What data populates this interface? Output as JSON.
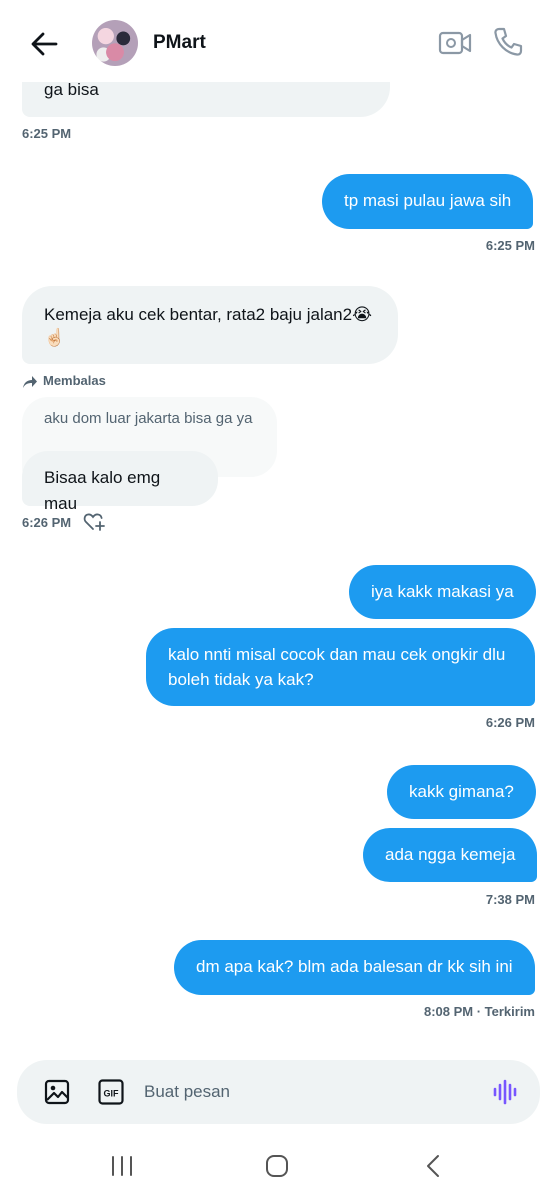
{
  "header": {
    "contact_name": "PMart"
  },
  "messages": {
    "m1_text": "ga bisa",
    "m1_time": "6:25 PM",
    "m2_text": "tp masi pulau jawa sih",
    "m2_time": "6:25 PM",
    "m3_text_line1": "Kemeja aku cek bentar, rata2 baju jalan2😭",
    "m3_text_line2": "☝🏻",
    "reply_label": "Membalas",
    "reply_quote": "aku dom luar jakarta bisa ga ya",
    "m4_text": "Bisaa kalo emg mau",
    "m4_time": "6:26 PM",
    "m5_text": "iya kakk makasi ya",
    "m6_text_line1": "kalo nnti misal cocok dan mau cek ongkir dlu",
    "m6_text_line2": "boleh tidak ya kak?",
    "m6_time": "6:26 PM",
    "m7_text": "kakk gimana?",
    "m8_text": "ada ngga kemeja",
    "m8_time": "7:38 PM",
    "m9_text": "dm apa kak? blm ada balesan dr kk sih ini",
    "m9_time": "8:08 PM · Terkirim"
  },
  "composer": {
    "placeholder": "Buat pesan",
    "gif_label": "GIF"
  },
  "colors": {
    "accent": "#1d9bf0",
    "incoming_bubble": "#eff3f4",
    "muted_text": "#536471",
    "voice_icon": "#7856ff"
  }
}
